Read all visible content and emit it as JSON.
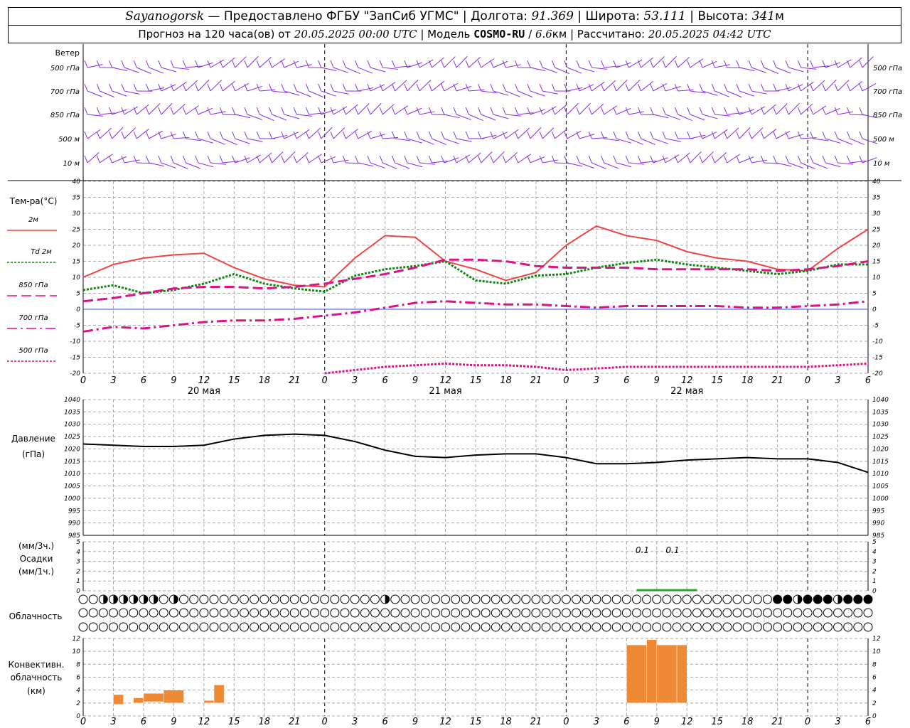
{
  "header": {
    "station": "Sayanogorsk",
    "dash": " — ",
    "provider": "Предоставлено ФГБУ \"ЗапСиб УГМС\"",
    "lon_label": "Долгота:",
    "lon": "91.369",
    "lat_label": "Широта:",
    "lat": "53.111",
    "alt_label": "Высота:",
    "alt": "341",
    "alt_unit": "м",
    "forecast_label": "Прогноз на 120 часа(ов) от",
    "forecast_start": "20.05.2025 00:00 UTC",
    "model_label": "Модель",
    "model": "COSMO-RU",
    "resolution": "6.6",
    "res_unit": "км",
    "computed_label": "Рассчитано:",
    "computed": "20.05.2025 04:42 UTC"
  },
  "wind_panel": {
    "title": "Ветер",
    "levels": [
      "500 гПа",
      "700 гПа",
      "850 гПа",
      "500 м",
      "10 м"
    ],
    "color": "#8a2be2"
  },
  "chart_data": [
    {
      "type": "line",
      "title": "Тем-ра(°C)",
      "x_hours": [
        0,
        3,
        6,
        9,
        12,
        15,
        18,
        21,
        24,
        27,
        30,
        33,
        36,
        39,
        42,
        45,
        48,
        51,
        54,
        57,
        60,
        63,
        66,
        69,
        72,
        75,
        78
      ],
      "ylim": [
        -20,
        40
      ],
      "yticks": [
        -20,
        -15,
        -10,
        -5,
        0,
        5,
        10,
        15,
        20,
        25,
        30,
        35,
        40
      ],
      "series": [
        {
          "name": "2м",
          "color": "#ee4444",
          "style": "solid",
          "values": [
            10,
            14,
            16,
            17,
            17.5,
            13,
            9.5,
            7.5,
            7,
            16,
            23,
            22.5,
            15,
            12.5,
            9,
            11.5,
            20,
            26,
            23,
            21.5,
            18,
            16,
            15,
            12.5,
            12,
            19,
            25
          ]
        },
        {
          "name": "Td 2м",
          "color": "#118811",
          "style": "dotted",
          "values": [
            6,
            7.5,
            5,
            6,
            8,
            11,
            8,
            6.5,
            5.5,
            10.5,
            12.5,
            13.5,
            15,
            9,
            8,
            10.5,
            11,
            13,
            14.5,
            15.5,
            14,
            13,
            12,
            11,
            12,
            14,
            14
          ]
        },
        {
          "name": "850 гПа",
          "color": "#dd1188",
          "style": "dashed",
          "values": [
            2.5,
            3.5,
            5,
            6.5,
            7,
            7,
            6.5,
            7,
            8,
            9.5,
            11,
            13,
            15.5,
            15.5,
            15,
            13.5,
            13,
            13,
            13,
            12.5,
            12.5,
            12.5,
            12.5,
            12,
            12.5,
            13.5,
            15
          ]
        },
        {
          "name": "700 гПа",
          "color": "#dd1188",
          "style": "dashdot",
          "values": [
            -7,
            -5.5,
            -6,
            -5,
            -4,
            -3.5,
            -3.5,
            -3,
            -2,
            -1,
            0.5,
            2,
            2.5,
            2,
            1.5,
            1.5,
            1,
            0.5,
            1,
            1,
            1,
            1,
            0.5,
            0.5,
            1,
            1.5,
            2.5
          ]
        },
        {
          "name": "500 гПа",
          "color": "#dd1188",
          "style": "dotted",
          "values": [
            null,
            null,
            null,
            null,
            null,
            null,
            null,
            null,
            -20,
            -19,
            -18,
            -17.5,
            -17,
            -17.5,
            -17.5,
            -18,
            -19,
            -18.5,
            -18,
            -18,
            -18,
            -18,
            -18,
            -18,
            -18,
            -17.5,
            -17
          ]
        }
      ]
    },
    {
      "type": "line",
      "title": "Давление",
      "unit": "(гПа)",
      "x_hours": [
        0,
        3,
        6,
        9,
        12,
        15,
        18,
        21,
        24,
        27,
        30,
        33,
        36,
        39,
        42,
        45,
        48,
        51,
        54,
        57,
        60,
        63,
        66,
        69,
        72,
        75,
        78
      ],
      "ylim": [
        985,
        1040
      ],
      "yticks": [
        985,
        990,
        995,
        1000,
        1005,
        1010,
        1015,
        1020,
        1025,
        1030,
        1035,
        1040
      ],
      "series": [
        {
          "name": "Давление",
          "color": "#000000",
          "style": "solid",
          "values": [
            1022,
            1021.5,
            1021,
            1021,
            1021.5,
            1024,
            1025.5,
            1026,
            1025.5,
            1023,
            1019.5,
            1017,
            1016.5,
            1017.5,
            1018,
            1018,
            1016.5,
            1014,
            1014,
            1014.5,
            1015.5,
            1016,
            1016.5,
            1016,
            1016,
            1014.5,
            1010.5
          ]
        }
      ]
    },
    {
      "type": "bar",
      "title": "Осадки",
      "unit_top": "(мм/3ч.)",
      "unit_bottom": "(мм/1ч.)",
      "ylim": [
        0,
        5
      ],
      "yticks": [
        0,
        1,
        2,
        3,
        4,
        5
      ],
      "annotations": [
        {
          "hour": 55,
          "text": "0.1"
        },
        {
          "hour": 58,
          "text": "0.1"
        }
      ],
      "bars": [
        {
          "hour": 55,
          "value": 0.1
        },
        {
          "hour": 58,
          "value": 0.1
        }
      ],
      "color": "#22aa22"
    },
    {
      "type": "bar",
      "title": "Конвективн. облачность",
      "unit": "(км)",
      "ylim": [
        0,
        12
      ],
      "yticks": [
        0,
        2,
        4,
        6,
        8,
        10,
        12
      ],
      "color": "#ee8a33",
      "bars": [
        {
          "start": 3,
          "end": 4,
          "bottom": 1.8,
          "top": 3.3
        },
        {
          "start": 5,
          "end": 6,
          "bottom": 2.0,
          "top": 2.8
        },
        {
          "start": 6,
          "end": 8,
          "bottom": 2.2,
          "top": 3.5
        },
        {
          "start": 8,
          "end": 10,
          "bottom": 2.0,
          "top": 4.0
        },
        {
          "start": 12,
          "end": 13,
          "bottom": 2.0,
          "top": 2.4
        },
        {
          "start": 13,
          "end": 14,
          "bottom": 2.0,
          "top": 4.8
        },
        {
          "start": 54,
          "end": 56,
          "bottom": 2.0,
          "top": 11.0
        },
        {
          "start": 56,
          "end": 57,
          "bottom": 2.0,
          "top": 11.8
        },
        {
          "start": 57,
          "end": 59,
          "bottom": 2.0,
          "top": 11.0
        },
        {
          "start": 59,
          "end": 60,
          "bottom": 2.0,
          "top": 11.0
        }
      ]
    }
  ],
  "cloud_panel": {
    "title": "Облачность",
    "rows": [
      "000014444444444444444444500400000000000000000000000000000000000000000000000000000000000000400000000000000040000000000000000000000000040000000000000000000000000000000000000000000000000000001000000000000000044888888488888888888488888848800",
      "000000000000000000000000000000000000000000000000000000000000000000000000000000000000000000000000000000000000000000000000000000000000000000000000000000000000000000000000000000000000000000000000000000000000000000000000000000000000000000000000",
      "000000000000000000000000000000000000000000000000000000000000000000000000000000000000000000000000000000000000000000000000000000000000000000000000000000000000000000000000000000000000000000000000000000000000000000000000000000000000000000000000"
    ]
  },
  "time_axis": {
    "hour_labels": [
      "0",
      "3",
      "6",
      "9",
      "12",
      "15",
      "18",
      "21"
    ],
    "last_label": "6",
    "days": [
      "20 мая",
      "21 мая",
      "22 мая"
    ]
  },
  "temp_legend": [
    "2м",
    "Td  2м",
    "850 гПа",
    "700 гПа",
    "500 гПа"
  ]
}
